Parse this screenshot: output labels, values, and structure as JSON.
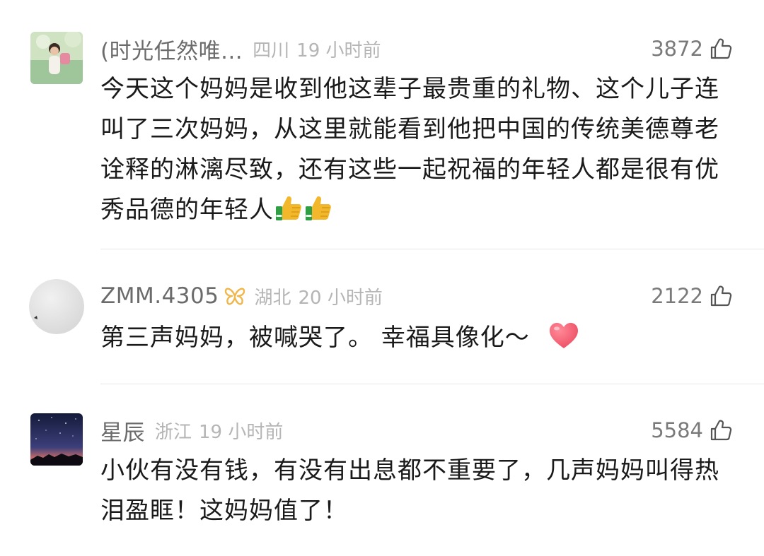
{
  "comments": [
    {
      "username": "(时光任然唯...",
      "location": "四川",
      "time": "19 小时前",
      "likes": "3872",
      "text": "今天这个妈妈是收到他这辈子最贵重的礼物、这个儿子连叫了三次妈妈，从这里就能看到他把中国的传统美德尊老诠释的淋漓尽致，还有这些一起祝福的年轻人都是很有优秀品德的年轻人",
      "emojis": [
        "thumbs-up-emoji",
        "thumbs-up-emoji"
      ]
    },
    {
      "username": "ZMM.4305",
      "badge": "butterfly-badge-icon",
      "location": "湖北",
      "time": "20 小时前",
      "likes": "2122",
      "text": "第三声妈妈，被喊哭了。 幸福具像化～",
      "emojis": [
        "heart-emoji"
      ]
    },
    {
      "username": "星辰",
      "location": "浙江",
      "time": "19 小时前",
      "likes": "5584",
      "text": "小伙有没有钱，有没有出息都不重要了，几声妈妈叫得热泪盈眶！这妈妈值了！",
      "emojis": []
    }
  ],
  "colors": {
    "username": "#6b6b6b",
    "meta": "#b5b5b5",
    "text": "#1a1a1a",
    "divider": "#e6e6e6",
    "badge": "#f0b64a",
    "heart": "#f0566a"
  }
}
